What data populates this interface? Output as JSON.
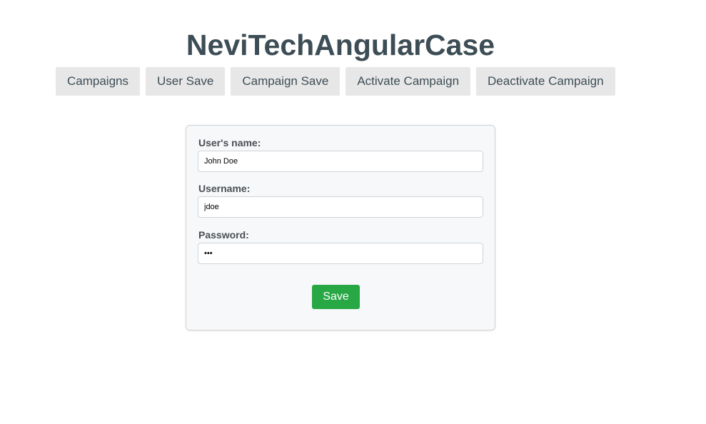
{
  "app": {
    "title": "NeviTechAngularCase"
  },
  "nav": {
    "items": [
      {
        "label": "Campaigns"
      },
      {
        "label": "User Save"
      },
      {
        "label": "Campaign Save"
      },
      {
        "label": "Activate Campaign"
      },
      {
        "label": "Deactivate Campaign"
      }
    ]
  },
  "form": {
    "name_label": "User's name:",
    "name_value": "John Doe",
    "username_label": "Username:",
    "username_value": "jdoe",
    "password_label": "Password:",
    "password_value": "•••",
    "save_label": "Save"
  },
  "colors": {
    "title": "#3d4d55",
    "nav_bg": "#e7e7e7",
    "save_bg": "#28a745"
  }
}
